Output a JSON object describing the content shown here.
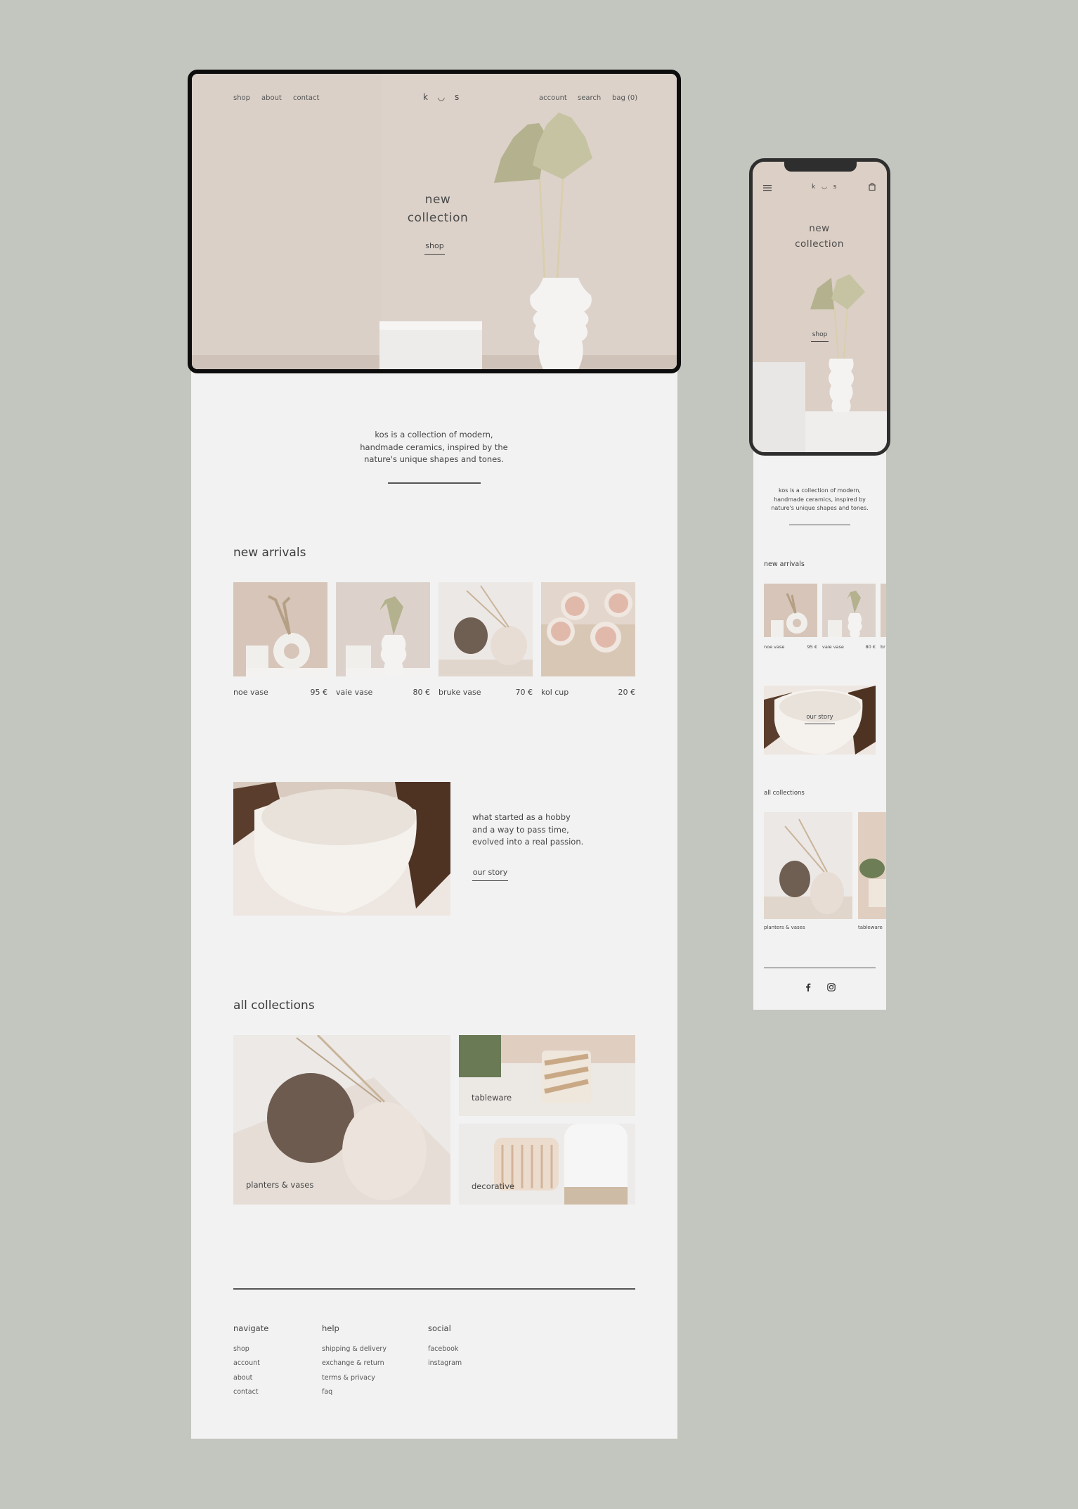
{
  "desktop": {
    "nav_left": [
      "shop",
      "about",
      "contact"
    ],
    "logo": "k ◡ s",
    "nav_right": [
      "account",
      "search",
      "bag (0)"
    ],
    "hero": {
      "title_line1": "new",
      "title_line2": "collection",
      "cta": "shop"
    },
    "intro": {
      "line1": "kos is a collection of modern,",
      "line2": "handmade ceramics, inspired by the",
      "line3": "nature's unique shapes and tones."
    },
    "new_arrivals": {
      "heading": "new arrivals",
      "items": [
        {
          "name": "noe vase",
          "price": "95 €"
        },
        {
          "name": "vaie vase",
          "price": "80 €"
        },
        {
          "name": "bruke vase",
          "price": "70 €"
        },
        {
          "name": "kol cup",
          "price": "20 €"
        }
      ]
    },
    "story": {
      "line1": "what started as a hobby",
      "line2": "and a way to pass time,",
      "line3": "evolved into a real passion.",
      "cta": "our story"
    },
    "collections": {
      "heading": "all collections",
      "items": [
        "planters & vases",
        "tableware",
        "decorative"
      ]
    },
    "footer": {
      "navigate": {
        "title": "navigate",
        "links": [
          "shop",
          "account",
          "about",
          "contact"
        ]
      },
      "help": {
        "title": "help",
        "links": [
          "shipping & delivery",
          "exchange & return",
          "terms & privacy",
          "faq"
        ]
      },
      "social": {
        "title": "social",
        "links": [
          "facebook",
          "instagram"
        ]
      }
    }
  },
  "mobile": {
    "logo": "k ◡ s",
    "hero": {
      "title_line1": "new",
      "title_line2": "collection",
      "cta": "shop"
    },
    "intro": {
      "line1": "kos is a collection of modern,",
      "line2": "handmade ceramics, inspired by",
      "line3": "nature's unique shapes and tones."
    },
    "new_arrivals": {
      "heading": "new arrivals",
      "items": [
        {
          "name": "noe vase",
          "price": "95 €"
        },
        {
          "name": "vaie vase",
          "price": "80 €"
        },
        {
          "name": "br",
          "price": ""
        }
      ]
    },
    "story_cta": "our story",
    "collections": {
      "heading": "all collections",
      "items": [
        "planters & vases",
        "tableware"
      ]
    },
    "social_icons": [
      "facebook-icon",
      "instagram-icon"
    ]
  },
  "colors": {
    "background": "#c3c6bf",
    "page": "#f2f2f2",
    "text": "#3b3b3b",
    "hero": "#dcd2ca"
  }
}
